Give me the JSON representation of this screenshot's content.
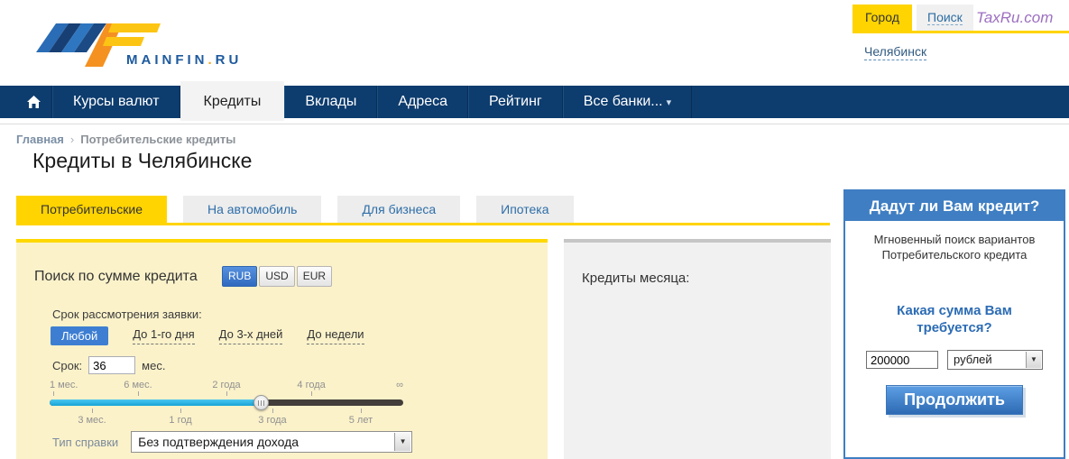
{
  "brand": {
    "logo_text": "MAINFIN",
    "logo_dot": ".",
    "logo_tld": "RU"
  },
  "header": {
    "city_tab": "Город",
    "search_tab": "Поиск",
    "partner_link": "TaxRu.com",
    "city_name": "Челябинск"
  },
  "nav": {
    "items": [
      {
        "label": "Курсы валют"
      },
      {
        "label": "Кредиты"
      },
      {
        "label": "Вклады"
      },
      {
        "label": "Адреса"
      },
      {
        "label": "Рейтинг"
      },
      {
        "label": "Все банки..."
      }
    ],
    "dropdown_arrow": "▾"
  },
  "breadcrumb": {
    "home": "Главная",
    "separator": "›",
    "current": "Потребительские кредиты"
  },
  "page_title": "Кредиты в Челябинске",
  "category_tabs": [
    {
      "label": "Потребительские"
    },
    {
      "label": "На автомобиль"
    },
    {
      "label": "Для бизнеса"
    },
    {
      "label": "Ипотека"
    }
  ],
  "search_panel": {
    "title": "Поиск по сумме кредита",
    "currencies": [
      {
        "label": "RUB"
      },
      {
        "label": "USD"
      },
      {
        "label": "EUR"
      }
    ],
    "review_label": "Срок рассмотрения заявки:",
    "review_options": [
      {
        "label": "Любой"
      },
      {
        "label": "До 1-го дня"
      },
      {
        "label": "До 3-х дней"
      },
      {
        "label": "До недели"
      }
    ],
    "term_label": "Срок:",
    "term_value": "36",
    "term_unit": "мес.",
    "slider": {
      "labels_top": [
        "1 мес.",
        "6 мес.",
        "2 года",
        "4 года",
        "∞"
      ],
      "labels_bottom": [
        "3 мес.",
        "1 год",
        "3 года",
        "5 лет"
      ]
    },
    "certificate_label": "Тип справки",
    "certificate_value": "Без подтверждения дохода",
    "select_arrow": "▼"
  },
  "credits_month_title": "Кредиты месяца:",
  "sidebar": {
    "title": "Дадут ли Вам кредит?",
    "subtitle": "Мгновенный поиск вариантов Потребительского кредита",
    "question": "Какая сумма Вам требуется?",
    "amount_value": "200000",
    "currency_value": "рублей",
    "select_arrow": "▼",
    "submit_label": "Продолжить"
  },
  "colors": {
    "navy": "#0d3c6e",
    "yellow": "#ffd400",
    "panel_yellow": "#fbf2ca",
    "blue_accent": "#3f7ec2",
    "cyan_track": "#29b6e8"
  }
}
